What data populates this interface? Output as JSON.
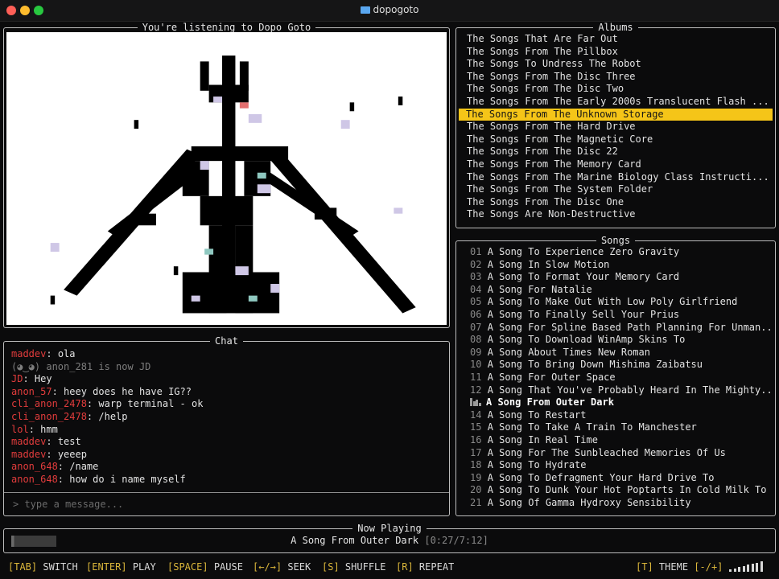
{
  "window": {
    "title": "dopogoto"
  },
  "visualizer": {
    "title": "You're listening to Dopo Goto"
  },
  "albums": {
    "title": "Albums",
    "selected_index": 6,
    "items": [
      "The Songs That Are Far Out",
      "The Songs From The Pillbox",
      "The Songs To Undress The Robot",
      "The Songs From The Disc Three",
      "The Songs From The Disc Two",
      "The Songs From The Early 2000s Translucent Flash ...",
      "The Songs From The Unknown Storage",
      "The Songs From The Hard Drive",
      "The Songs From The Magnetic Core",
      "The Songs From The Disc 22",
      "The Songs From The Memory Card",
      "The Songs From The Marine Biology Class Instructi...",
      "The Songs From The System Folder",
      "The Songs From The Disc One",
      "The Songs Are Non-Destructive"
    ]
  },
  "songs": {
    "title": "Songs",
    "playing_index": 12,
    "items": [
      {
        "num": "01",
        "title": "A Song To Experience Zero Gravity"
      },
      {
        "num": "02",
        "title": "A Song In Slow Motion"
      },
      {
        "num": "03",
        "title": "A Song To Format Your Memory Card"
      },
      {
        "num": "04",
        "title": "A Song For Natalie"
      },
      {
        "num": "05",
        "title": "A Song To Make Out With Low Poly Girlfriend"
      },
      {
        "num": "06",
        "title": "A Song To Finally Sell Your Prius"
      },
      {
        "num": "07",
        "title": "A Song For Spline Based Path Planning For Unman..."
      },
      {
        "num": "08",
        "title": "A Song To Download WinAmp Skins To"
      },
      {
        "num": "09",
        "title": "A Song About Times New Roman"
      },
      {
        "num": "10",
        "title": "A Song To Bring Down Mishima Zaibatsu"
      },
      {
        "num": "11",
        "title": "A Song For Outer Space"
      },
      {
        "num": "12",
        "title": "A Song That You've Probably Heard In The Mighty..."
      },
      {
        "num": "",
        "title": "A Song From Outer Dark"
      },
      {
        "num": "14",
        "title": "A Song To Restart"
      },
      {
        "num": "15",
        "title": "A Song To Take A Train To Manchester"
      },
      {
        "num": "16",
        "title": "A Song In Real Time"
      },
      {
        "num": "17",
        "title": "A Song For The Sunbleached Memories Of Us"
      },
      {
        "num": "18",
        "title": "A Song To Hydrate"
      },
      {
        "num": "19",
        "title": "A Song To Defragment Your Hard Drive To"
      },
      {
        "num": "20",
        "title": "A Song To Dunk Your Hot Poptarts In Cold Milk To"
      },
      {
        "num": "21",
        "title": "A Song Of Gamma Hydroxy Sensibility"
      }
    ]
  },
  "chat": {
    "title": "Chat",
    "messages": [
      {
        "user": "maddev",
        "text": "ola"
      },
      {
        "system": "(◕‿◕) anon_281 is now JD"
      },
      {
        "user": "JD",
        "text": "Hey"
      },
      {
        "user": "anon_57",
        "text": "heey does he have IG??"
      },
      {
        "user": "cli_anon_2478",
        "text": "warp terminal - ok"
      },
      {
        "user": "cli_anon_2478",
        "text": "/help"
      },
      {
        "user": "lol",
        "text": "hmm"
      },
      {
        "user": "maddev",
        "text": "test"
      },
      {
        "user": "maddev",
        "text": "yeeep"
      },
      {
        "user": "anon_648",
        "text": "/name"
      },
      {
        "user": "anon_648",
        "text": "how do i name myself"
      }
    ],
    "input_placeholder": "> type a message..."
  },
  "now_playing": {
    "title": "Now Playing",
    "song": "A Song From Outer Dark",
    "time": "[0:27/7:12]",
    "progress_fraction": 0.0625
  },
  "footer": {
    "items": [
      {
        "key": "[TAB]",
        "label": "SWITCH"
      },
      {
        "key": "[ENTER]",
        "label": "PLAY"
      },
      {
        "key": "[SPACE]",
        "label": "PAUSE"
      },
      {
        "key": "[←/→]",
        "label": "SEEK"
      },
      {
        "key": "[S]",
        "label": "SHUFFLE"
      },
      {
        "key": "[R]",
        "label": "REPEAT"
      }
    ],
    "theme": {
      "key": "[T]",
      "label": "THEME"
    },
    "volume": {
      "key": "[-/+]",
      "level_fraction": 1.0
    }
  },
  "colors": {
    "accent": "#f5c518",
    "chat_user": "#e23c3c",
    "key": "#d9b53a"
  }
}
